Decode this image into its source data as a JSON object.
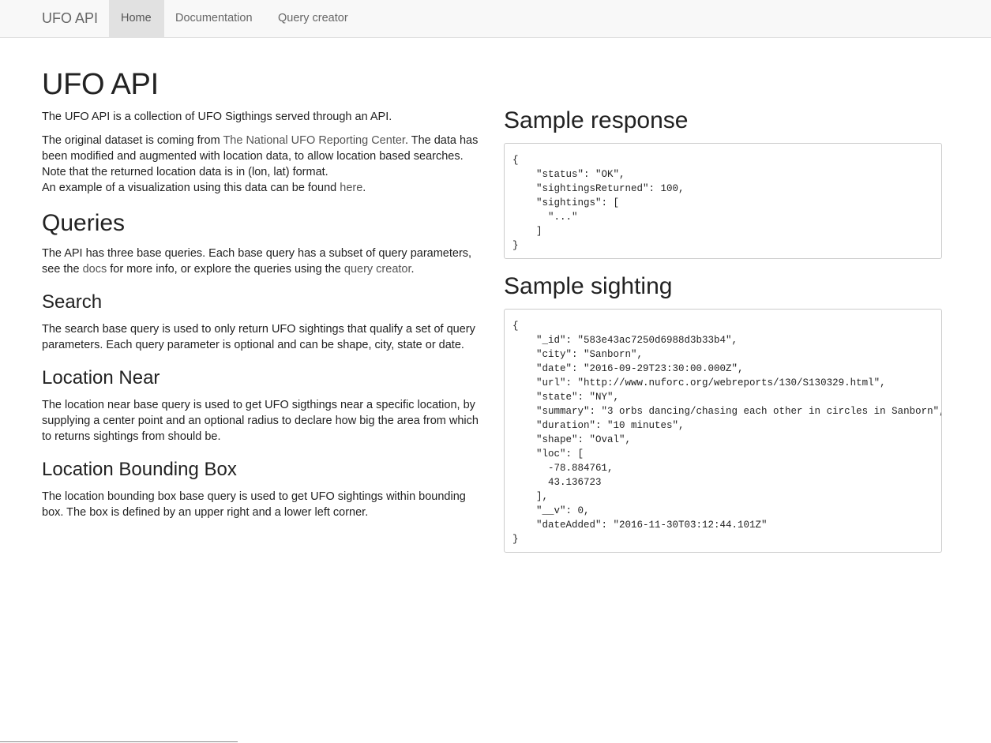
{
  "navbar": {
    "brand": "UFO API",
    "items": [
      {
        "label": "Home",
        "active": true
      },
      {
        "label": "Documentation",
        "active": false
      },
      {
        "label": "Query creator",
        "active": false
      }
    ]
  },
  "main": {
    "title": "UFO API",
    "intro": "The UFO API is a collection of UFO Sigthings served through an API.",
    "dataset": {
      "before_link": "The original dataset is coming from ",
      "link": "The National UFO Reporting Center",
      "after_link": ". The data has been modified and augmented with location data, to allow location based searches. Note that the returned location data is in (lon, lat) format.",
      "example_before": "An example of a visualization using this data can be found ",
      "example_link": "here",
      "example_after": "."
    },
    "queries": {
      "heading": "Queries",
      "p_before": "The API has three base queries. Each base query has a subset of query parameters, see the ",
      "docs_link": "docs",
      "p_middle": " for more info, or explore the queries using the ",
      "creator_link": "query creator",
      "p_after": "."
    },
    "search": {
      "heading": "Search",
      "text": "The search base query is used to only return UFO sightings that qualify a set of query parameters. Each query parameter is optional and can be shape, city, state or date."
    },
    "near": {
      "heading": "Location Near",
      "text": "The location near base query is used to get UFO sigthings near a specific location, by supplying a center point and an optional radius to declare how big the area from which to returns sightings from should be."
    },
    "bbox": {
      "heading": "Location Bounding Box",
      "text": "The location bounding box base query is used to get UFO sightings within bounding box. The box is defined by an upper right and a lower left corner."
    }
  },
  "samples": {
    "response_heading": "Sample response",
    "response_code": "{\n    \"status\": \"OK\",\n    \"sightingsReturned\": 100,\n    \"sightings\": [\n      \"...\"\n    ]\n}",
    "sighting_heading": "Sample sighting",
    "sighting_code": "{\n    \"_id\": \"583e43ac7250d6988d3b33b4\",\n    \"city\": \"Sanborn\",\n    \"date\": \"2016-09-29T23:30:00.000Z\",\n    \"url\": \"http://www.nuforc.org/webreports/130/S130329.html\",\n    \"state\": \"NY\",\n    \"summary\": \"3 orbs dancing/chasing each other in circles in Sanborn\",\n    \"duration\": \"10 minutes\",\n    \"shape\": \"Oval\",\n    \"loc\": [\n      -78.884761,\n      43.136723\n    ],\n    \"__v\": 0,\n    \"dateAdded\": \"2016-11-30T03:12:44.101Z\"\n}"
  }
}
